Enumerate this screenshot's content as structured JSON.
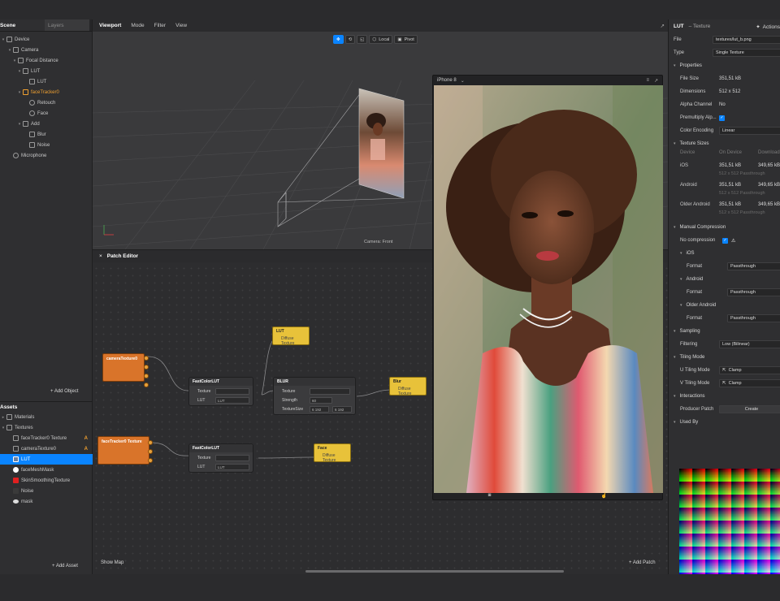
{
  "left": {
    "tabs": [
      "Scene",
      "Layers"
    ],
    "scene_items": [
      {
        "label": "Device",
        "icon": "device-icon"
      },
      {
        "label": "Camera",
        "icon": "camera-icon"
      },
      {
        "label": "Focal Distance",
        "icon": "focal-icon"
      },
      {
        "label": "LUT",
        "icon": "plane-icon"
      },
      {
        "label": "LUT",
        "icon": "plane-icon"
      },
      {
        "label": "faceTracker0",
        "icon": "face-tracker-icon"
      },
      {
        "label": "Retouch",
        "icon": "retouch-icon"
      },
      {
        "label": "Face",
        "icon": "face-icon"
      },
      {
        "label": "Add",
        "icon": "plane-icon"
      },
      {
        "label": "Blur",
        "icon": "plane-icon"
      },
      {
        "label": "Noise",
        "icon": "plane-icon"
      },
      {
        "label": "Microphone",
        "icon": "microphone-icon"
      }
    ],
    "add_object": "+ Add Object",
    "assets_title": "Assets",
    "assets_items": [
      {
        "label": "Materials",
        "badge": ""
      },
      {
        "label": "Textures",
        "badge": ""
      },
      {
        "label": "faceTracker0 Texture",
        "badge": "A"
      },
      {
        "label": "cameraTexture0",
        "badge": "A"
      },
      {
        "label": "LUT",
        "badge": ""
      },
      {
        "label": "faceMeshMask",
        "badge": ""
      },
      {
        "label": "SkinSmoothingTexture",
        "badge": ""
      },
      {
        "label": "Noise",
        "badge": ""
      },
      {
        "label": "mask",
        "badge": ""
      }
    ],
    "add_asset": "+ Add Asset"
  },
  "viewport": {
    "tabs": [
      "Viewport",
      "Mode",
      "Filter",
      "View"
    ],
    "local": "Local",
    "pivot": "Pivot",
    "camera_label": "Camera: Front"
  },
  "patch": {
    "close": "×",
    "title": "Patch Editor",
    "show_map": "Show Map",
    "add_patch": "+ Add Patch",
    "nodes": {
      "camera_texture": "cameraTexture0",
      "face_tracker_texture": "faceTracker0 Texture",
      "fastcolorlut_title": "FastColorLUT",
      "texture_label": "Texture",
      "lut_label": "LUT",
      "lut_value": "LUT",
      "blur_title": "BLUR",
      "strength_label": "Strength",
      "strength_value": "60",
      "texturesize_label": "TextureSize",
      "texturesize_x": "6 192",
      "texturesize_y": "6 192",
      "out_lut_title": "LUT",
      "out_blur_title": "Blur",
      "out_face_title": "Face",
      "diffuse_texture": "Diffuse Texture"
    }
  },
  "preview": {
    "device": "iPhone 8"
  },
  "inspector": {
    "title": "LUT",
    "subtitle": "– Texture",
    "actions": "Actions",
    "file_label": "File",
    "file_value": "textures/lut_b.png",
    "type_label": "Type",
    "type_value": "Single Texture",
    "properties_title": "Properties",
    "file_size_label": "File Size",
    "file_size_value": "351,51 kB",
    "dimensions_label": "Dimensions",
    "dimensions_value": "512 x 512",
    "alpha_label": "Alpha Channel",
    "alpha_value": "No",
    "premultiply_label": "Premultiply Alp...",
    "color_encoding_label": "Color Encoding",
    "color_encoding_value": "Linear",
    "texture_sizes_title": "Texture Sizes",
    "ts_head": [
      "Device",
      "On Device",
      "Download"
    ],
    "ts_rows": [
      {
        "device": "iOS",
        "on": "351,51 kB",
        "dl": "349,65 kB",
        "sub": "512 x 512 Passthrough"
      },
      {
        "device": "Android",
        "on": "351,51 kB",
        "dl": "349,65 kB",
        "sub": "512 x 512 Passthrough"
      },
      {
        "device": "Older Android",
        "on": "351,51 kB",
        "dl": "349,65 kB",
        "sub": "512 x 512 Passthrough"
      }
    ],
    "manual_compression_title": "Manual Compression",
    "no_compression_label": "No compression",
    "ios_title": "iOS",
    "android_title": "Android",
    "older_android_title": "Older Android",
    "format_label": "Format",
    "format_value": "Passthrough",
    "sampling_title": "Sampling",
    "filtering_label": "Filtering",
    "filtering_value": "Low (Bilinear)",
    "tiling_title": "Tiling Mode",
    "u_tiling_label": "U Tiling Mode",
    "v_tiling_label": "V Tiling Mode",
    "clamp_value": "Clamp",
    "interactions_title": "Interactions",
    "producer_patch_label": "Producer Patch",
    "create_label": "Create",
    "used_by_title": "Used By"
  },
  "colors": {
    "accent": "#0a84ff",
    "orange_node": "#d9742a",
    "yellow_node": "#e8c23a"
  }
}
